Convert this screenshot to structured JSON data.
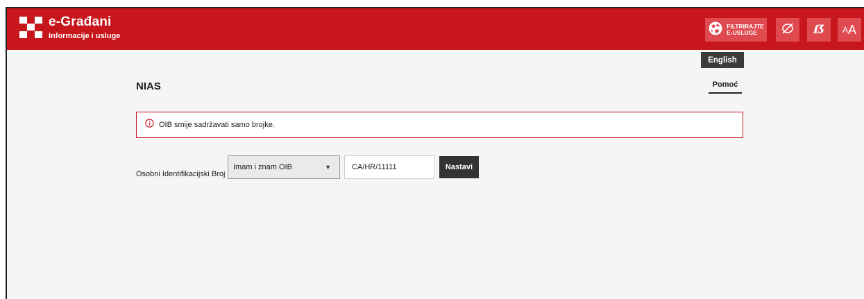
{
  "header": {
    "brand_title": "e-Građani",
    "brand_subtitle": "Informacije i usluge",
    "filter_line1": "FILTRIRAJTE",
    "filter_line2": "E-USLUGE",
    "dyslexic_label": "ẞ",
    "font_size_small": "A",
    "font_size_big": "A",
    "background_color": "#c8161d"
  },
  "language": {
    "label": "English"
  },
  "page": {
    "title": "NIAS",
    "help_link": "Pomoć"
  },
  "alert": {
    "icon": "info-circle-icon",
    "message": "OIB smije sadržavati samo brojke."
  },
  "form": {
    "label": "Osobni Identifikacijski Broj",
    "select_value": "Imam i znam OIB",
    "input_value": "CA/HR/11111",
    "submit_label": "Nastavi"
  }
}
